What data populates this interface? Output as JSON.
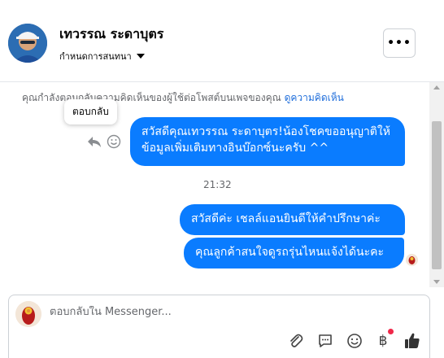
{
  "header": {
    "name": "เทวรรณ ระดาบุตร",
    "subtitle": "กำหนดการสนทนา",
    "more_label": "•••"
  },
  "thread": {
    "notice_text": "คุณกำลังตอบกลับความคิดเห็นของผู้ใช้ต่อโพสต์บนเพจของคุณ",
    "notice_link": "ดูความคิดเห็น",
    "tooltip": "ตอบกลับ",
    "messages": [
      {
        "text": "สวัสดีคุณเทวรรณ ระดาบุตร!น้องโชคขออนุญาติให้ข้อมูลเพิ่มเติมทางอินบ๊อกซ์นะครับ ^^"
      },
      {
        "text": "สวัสดีค่ะ เชลล์แอนยินดีให้คำปรึกษาค่ะ"
      },
      {
        "text": "คุณลูกค้าสนใจดูรถรุ่นไหนแจ้งได้นะคะ"
      }
    ],
    "timestamp": "21:32"
  },
  "composer": {
    "placeholder": "ตอบกลับใน Messenger...",
    "value": "",
    "baht_symbol": "฿"
  },
  "icons": {
    "reply": "reply-icon",
    "emoji": "smiley-icon",
    "attach": "paperclip-icon",
    "chat": "speech-bubble-icon",
    "emoji2": "smiley-icon",
    "baht": "baht-icon",
    "like": "thumbs-up-icon"
  },
  "colors": {
    "accent": "#0a7cff",
    "link": "#216fdb",
    "muted": "#65676b",
    "notification_dot": "#f02849"
  }
}
